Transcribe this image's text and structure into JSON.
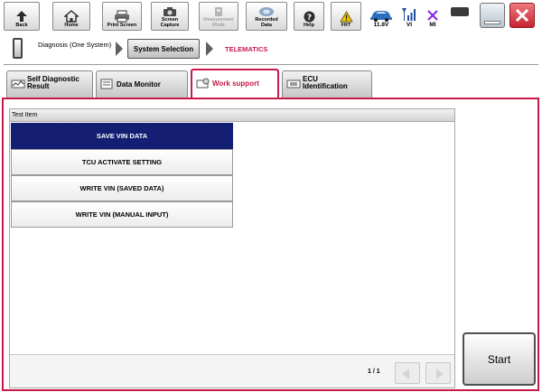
{
  "toolbar": {
    "back": "Back",
    "home": "Home",
    "print_screen": "Print Screen",
    "screen_capture": "Screen\nCapture",
    "measurement_mode": "Measurement\nMode",
    "recorded_data": "Recorded\nData",
    "help": "Help",
    "frt": "FRT",
    "voltage": "11.8V",
    "vi": "VI",
    "mi": "MI"
  },
  "breadcrumb": {
    "root": "Diagnosis (One\nSystem)",
    "system_selection": "System Selection",
    "current": "TELEMATICS"
  },
  "tabs": {
    "self_diagnostic": "Self Diagnostic\nResult",
    "data_monitor": "Data Monitor",
    "work_support": "Work support",
    "ecu_identification": "ECU\nIdentification"
  },
  "list": {
    "header": "Test Item",
    "items": [
      "SAVE VIN DATA",
      "TCU ACTIVATE SETTING",
      "WRITE VIN (SAVED DATA)",
      "WRITE VIN (MANUAL INPUT)"
    ],
    "selected_index": 0
  },
  "pager": {
    "page": "1 / 1"
  },
  "start_label": "Start",
  "colors": {
    "accent": "#c8194b",
    "selected_row": "#141e72",
    "close_button": "#e0424e",
    "car_icon": "#2a6fbf",
    "signal_icon": "#1f4fa0",
    "mi_icon": "#8a2be2",
    "warning_icon": "#f2c200"
  }
}
